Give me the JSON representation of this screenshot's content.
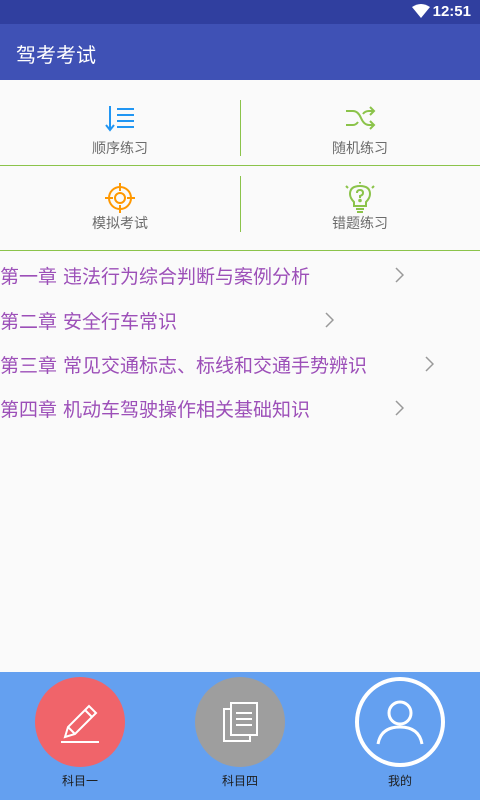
{
  "status_bar": {
    "time": "12:51",
    "icons": [
      "wifi-icon"
    ]
  },
  "app_bar": {
    "title": "驾考考试"
  },
  "grid": [
    {
      "label": "顺序练习",
      "icon": "sequence-list-icon",
      "color": "#2196f3"
    },
    {
      "label": "随机练习",
      "icon": "shuffle-icon",
      "color": "#8bc34a"
    },
    {
      "label": "模拟考试",
      "icon": "target-icon",
      "color": "#ff9800"
    },
    {
      "label": "错题练习",
      "icon": "lightbulb-question-icon",
      "color": "#8bc34a"
    }
  ],
  "chapters": [
    {
      "label": "第一章 违法行为综合判断与案例分析"
    },
    {
      "label": "第二章 安全行车常识"
    },
    {
      "label": "第三章 常见交通标志、标线和交通手势辨识"
    },
    {
      "label": "第四章 机动车驾驶操作相关基础知识"
    }
  ],
  "bottom_nav": [
    {
      "label": "科目一",
      "icon": "pencil-icon",
      "color": "#f0646a"
    },
    {
      "label": "科目四",
      "icon": "documents-icon",
      "color": "#9e9e9e"
    },
    {
      "label": "我的",
      "icon": "user-icon",
      "color": "#ffffff"
    }
  ],
  "colors": {
    "status_bar": "#303f9f",
    "app_bar": "#3f51b5",
    "divider": "#8bc34a",
    "chapter_text": "#9c4fb8",
    "bottom_bar": "#64a0f0"
  }
}
